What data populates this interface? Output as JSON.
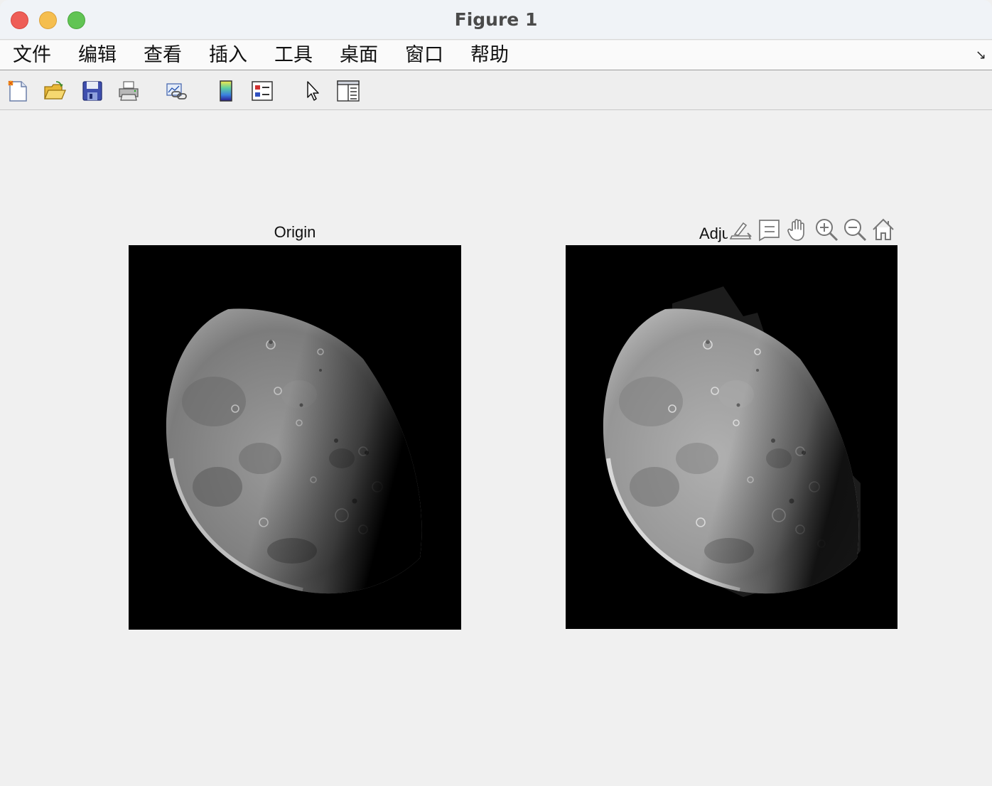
{
  "window": {
    "title": "Figure 1"
  },
  "menu": {
    "items": [
      "文件",
      "编辑",
      "查看",
      "插入",
      "工具",
      "桌面",
      "窗口",
      "帮助"
    ],
    "overflow_icon": "dock-arrow-icon"
  },
  "toolbar": {
    "buttons": [
      "new-figure-icon",
      "open-file-icon",
      "save-icon",
      "print-icon",
      "link-plot-icon",
      "colorbar-icon",
      "legend-icon",
      "pointer-icon",
      "property-inspector-icon"
    ]
  },
  "axes": [
    {
      "title": "Origin",
      "image": "moon-original"
    },
    {
      "title": "Adju",
      "image": "moon-adjusted"
    }
  ],
  "axes_toolbar": {
    "buttons": [
      "brush-icon",
      "data-tips-icon",
      "pan-hand-icon",
      "zoom-in-icon",
      "zoom-out-icon",
      "home-icon"
    ]
  }
}
